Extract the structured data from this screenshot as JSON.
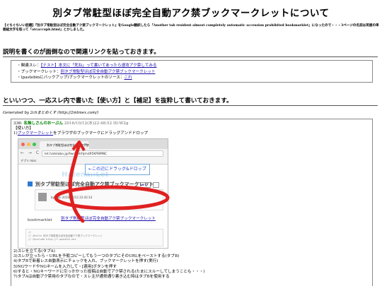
{
  "title": "別タブ常駐型ほぼ完全自動アク禁ブックマークレットについて",
  "note": "【ぐちぐちいい話題】『別タブ常駐型ほぼ完全自動アク禁ブックマークレット』をGoogle翻訳したら「Another tab resident almost completely automatic accession prohibited bookmarklet」になったので・・・3ページの名前は英語の単語組文字を取って「atcaccupb.html」とかしました。",
  "section1": {
    "heading": "説明を書くのが面倒なので関連リンクを貼っておきます。",
    "links": [
      {
        "prefix": "・関連スレ：",
        "link": "【テスト】本文に「死ね」って書いてあったら速攻アク禁してみる"
      },
      {
        "prefix": "・ブックマークレット：",
        "link": "別タブ常駐型ほぼ完全自動アク禁ブックマークレット"
      },
      {
        "prefix": "・(pastebinにバックアップ)ブックマークレットのソース：",
        "link": "これ"
      }
    ]
  },
  "section2": {
    "heading": "といいつつ、一応スレ内で書いた【使い方】と【補足】を抜粋して書いておきます。",
    "generated": "Generated by 2chまとめくす (http://2mtmex.com/)"
  },
  "post": {
    "number": "336:",
    "name": "名無しさんのおーぷん",
    "date": "2016/10/12(水)22:48:52 ID:W2g",
    "section_label": "【使い方】",
    "step1_prefix": "1)",
    "step1_link": "ブックマークレット",
    "step1_suffix": "をブラウザのブックマークにドラッグアンドドロップ",
    "steps": [
      "2)スレを立てる(タブA)",
      "3)スレが立ったら・URLを予般コピーしてもう一つのタブにそのURLをペーストする(タブB)",
      "4)タブBで新着レス自動表示にチェックを入れ、ブックマークレットを押す(実行)",
      "5)NGワードやNGネームを入力して・[適用]ボタンを押す",
      "6)すると・NGキーワードに引っかかった投稿は自動でアク禁される(たまにスルーしてしまうことも・・・)",
      "7)タブAは自動アク禁用のタブなので・スレ主が通常通り書き込む時はタブBを使用する"
    ]
  },
  "screenshot": {
    "tab_title": "別タブ常駐型ほぼ完全自動アク禁",
    "tab_close": "×",
    "nav_icons": "← → C",
    "url": "let.hatelabo.jp/Awn/let/hJmd95KP8MNC",
    "bookmarks_bar": "アプリ misc",
    "logo": "Hatena::Let",
    "drag_label": "←この辺にドラッグ&ドロップ",
    "page_title": "別タブ常駐型ほぼ完全自動アク禁ブックマークレット",
    "fork": "Fork",
    "byline": "by Awn   2016/10/12 22:43:14",
    "bookmarklet_label": "bookmarklet",
    "bookmarklet_link": "別タブ常駐型ほぼ完全自動アク禁ブックマークレット",
    "code_lines": [
      "//",
      "// @title 別タブ常駐型ほぼ完全自動アク禁ブックマークレット",
      "// @include http://*.open2ch.net"
    ]
  },
  "colors": {
    "link": "#1a0dab",
    "name_green": "#008000",
    "annotation_red": "#e02020",
    "annotation_blue": "#1a3fd6"
  }
}
